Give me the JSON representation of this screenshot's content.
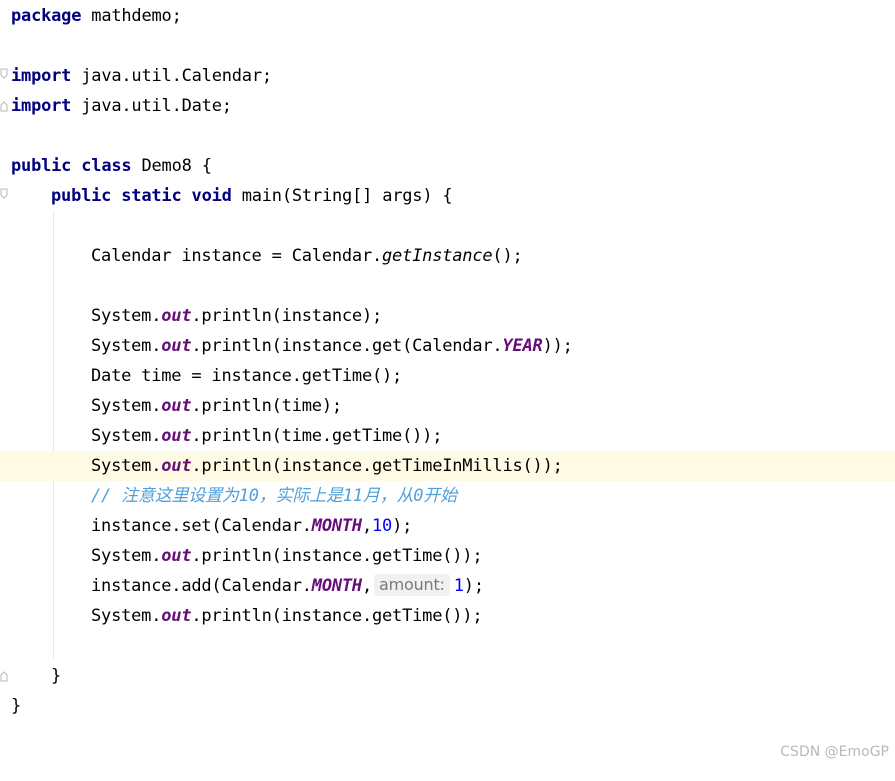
{
  "editor": {
    "lines": {
      "l1": {
        "kw": "package",
        "rest": " mathdemo;"
      },
      "l3": {
        "kw": "import",
        "rest": " java.util.Calendar;"
      },
      "l4": {
        "kw": "import",
        "rest": " java.util.Date;"
      },
      "l6": {
        "kw1": "public",
        "kw2": "class",
        "rest": " Demo8 {"
      },
      "l7": {
        "kw1": "public",
        "kw2": "static",
        "kw3": "void",
        "rest": " main(String[] args) {"
      },
      "l9": {
        "pre": "Calendar instance = Calendar.",
        "call": "getInstance",
        "post": "();"
      },
      "l11": {
        "pre": "System.",
        "field": "out",
        "post": ".println(instance);"
      },
      "l12": {
        "pre": "System.",
        "field": "out",
        "mid": ".println(instance.get(Calendar.",
        "field2": "YEAR",
        "post": "));"
      },
      "l13": {
        "text": "Date time = instance.getTime();"
      },
      "l14": {
        "pre": "System.",
        "field": "out",
        "post": ".println(time);"
      },
      "l15": {
        "pre": "System.",
        "field": "out",
        "post": ".println(time.getTime());"
      },
      "l16": {
        "pre": "System.",
        "field": "out",
        "post": ".println(instance.getTimeInMillis());"
      },
      "l17": {
        "comment": "// 注意这里设置为10，实际上是11月，从0开始"
      },
      "l18": {
        "pre": "instance.set(Calendar.",
        "field": "MONTH",
        "mid": ",",
        "num": "10",
        "post": ");"
      },
      "l19": {
        "pre": "System.",
        "field": "out",
        "post": ".println(instance.getTime());"
      },
      "l20": {
        "pre": "instance.add(Calendar.",
        "field": "MONTH",
        "mid": ",",
        "hint": "amount:",
        "num": "1",
        "post": ");"
      },
      "l21": {
        "pre": "System.",
        "field": "out",
        "post": ".println(instance.getTime());"
      },
      "l23": {
        "text": "}"
      },
      "l24": {
        "text": "}"
      }
    },
    "colors": {
      "keyword": "#000080",
      "static_field": "#660e7a",
      "number": "#0000ff",
      "comment": "#4f9fd8",
      "current_line": "#fffae3"
    }
  },
  "watermark": "CSDN @EmoGP"
}
